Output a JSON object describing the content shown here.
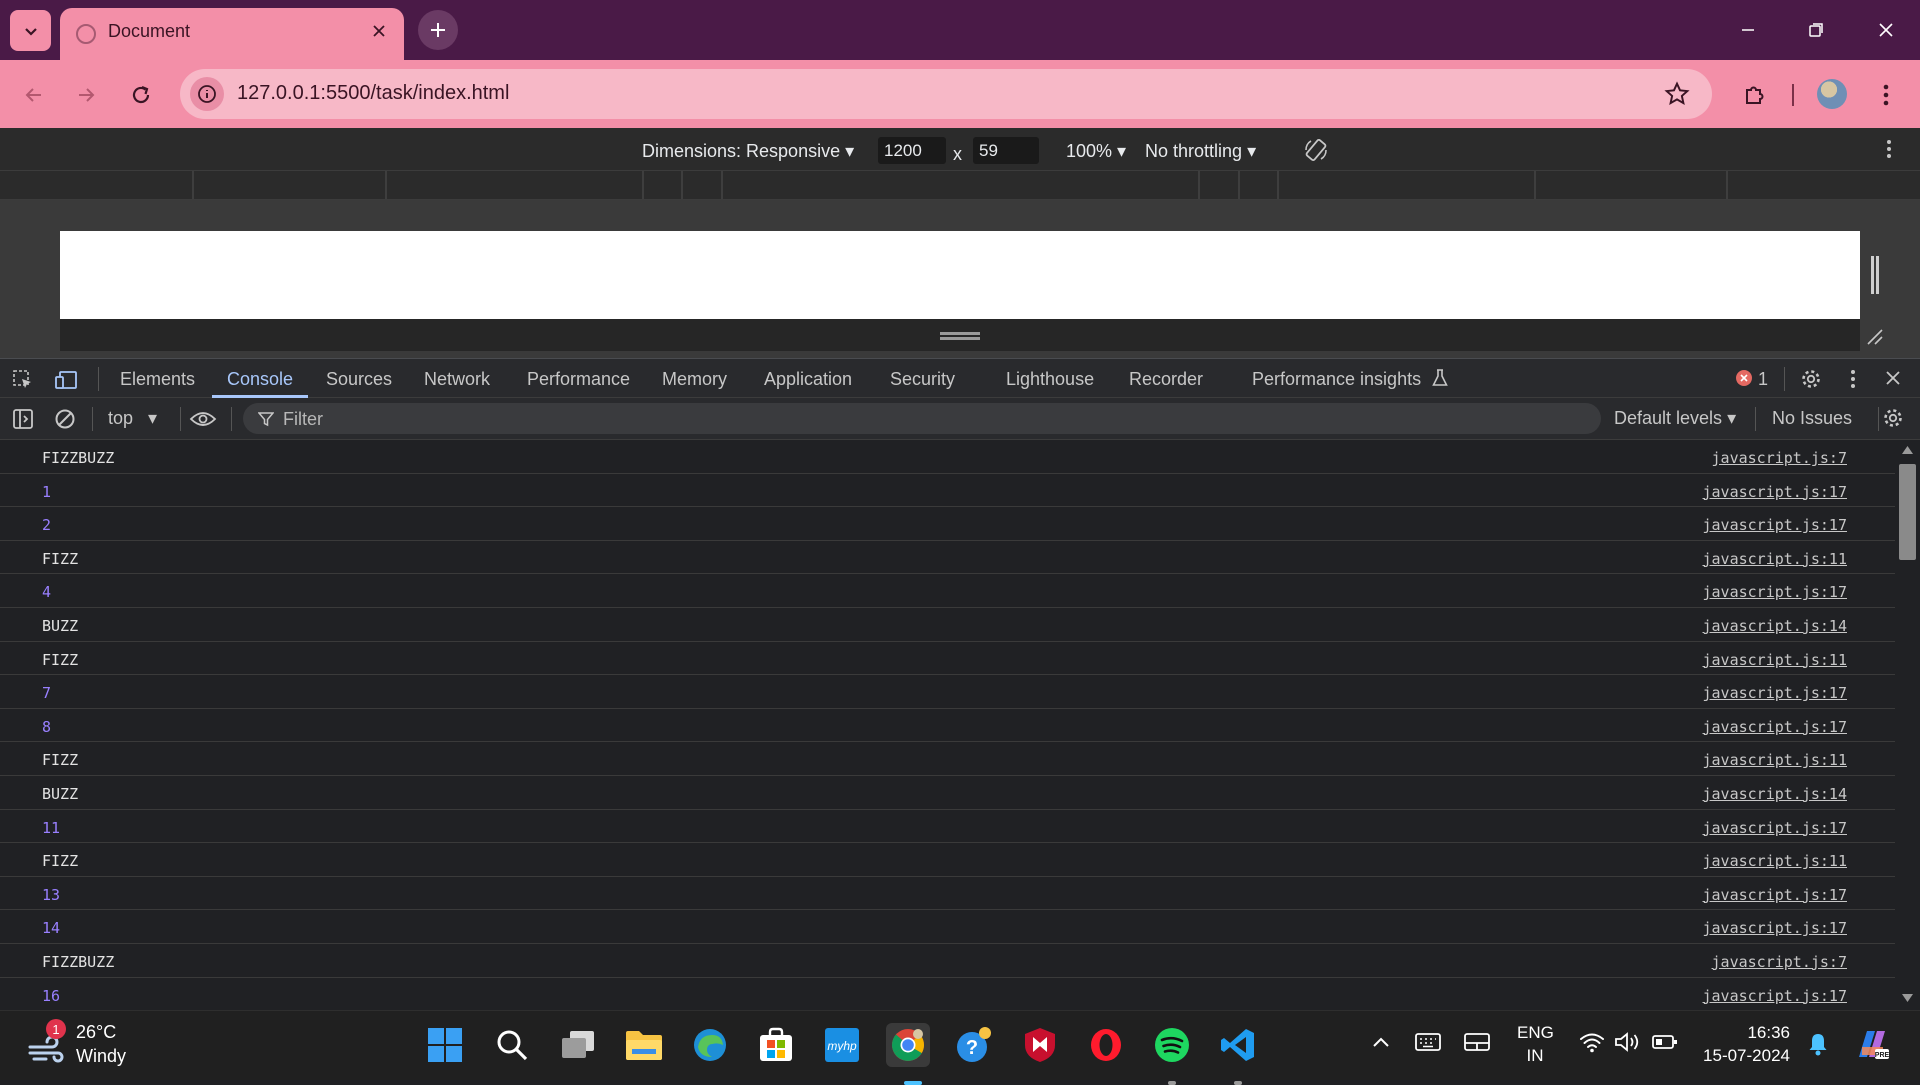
{
  "browser": {
    "tab_title": "Document",
    "url": "127.0.0.1:5500/task/index.html"
  },
  "device_toolbar": {
    "dimensions_label": "Dimensions: Responsive",
    "width": "1200",
    "times": "x",
    "height": "59",
    "zoom": "100%",
    "throttling": "No throttling"
  },
  "devtools": {
    "tabs": [
      "Elements",
      "Console",
      "Sources",
      "Network",
      "Performance",
      "Memory",
      "Application",
      "Security",
      "Lighthouse",
      "Recorder",
      "Performance insights"
    ],
    "active_tab": "Console",
    "error_count": "1"
  },
  "console_toolbar": {
    "context": "top",
    "filter_placeholder": "Filter",
    "levels": "Default levels",
    "issues": "No Issues"
  },
  "console_rows": [
    {
      "msg": "FIZZBUZZ",
      "src": "javascript.js:7"
    },
    {
      "msg": "1",
      "src": "javascript.js:17"
    },
    {
      "msg": "2",
      "src": "javascript.js:17"
    },
    {
      "msg": "FIZZ",
      "src": "javascript.js:11"
    },
    {
      "msg": "4",
      "src": "javascript.js:17"
    },
    {
      "msg": "BUZZ",
      "src": "javascript.js:14"
    },
    {
      "msg": "FIZZ",
      "src": "javascript.js:11"
    },
    {
      "msg": "7",
      "src": "javascript.js:17"
    },
    {
      "msg": "8",
      "src": "javascript.js:17"
    },
    {
      "msg": "FIZZ",
      "src": "javascript.js:11"
    },
    {
      "msg": "BUZZ",
      "src": "javascript.js:14"
    },
    {
      "msg": "11",
      "src": "javascript.js:17"
    },
    {
      "msg": "FIZZ",
      "src": "javascript.js:11"
    },
    {
      "msg": "13",
      "src": "javascript.js:17"
    },
    {
      "msg": "14",
      "src": "javascript.js:17"
    },
    {
      "msg": "FIZZBUZZ",
      "src": "javascript.js:7"
    },
    {
      "msg": "16",
      "src": "javascript.js:17"
    }
  ],
  "taskbar": {
    "weather_temp": "26°C",
    "weather_desc": "Windy",
    "weather_badge": "1",
    "lang_top": "ENG",
    "lang_bottom": "IN",
    "time": "16:36",
    "date": "15-07-2024"
  },
  "colors": {
    "titlebar": "#4a1a47",
    "tab_accent": "#f38fa8",
    "devtools_bg": "#202124",
    "active_tab": "#a8c7fa",
    "number_log": "#9980ff"
  }
}
